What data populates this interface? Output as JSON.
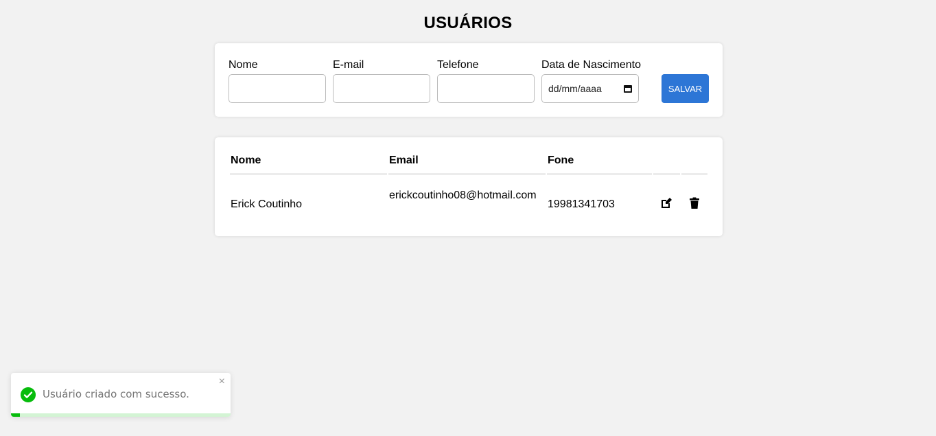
{
  "page": {
    "title": "USUÁRIOS"
  },
  "form": {
    "fields": [
      {
        "label": "Nome",
        "value": ""
      },
      {
        "label": "E-mail",
        "value": ""
      },
      {
        "label": "Telefone",
        "value": ""
      },
      {
        "label": "Data de Nascimento",
        "value": "dd/mm/aaaa"
      }
    ],
    "save_label": "SALVAR"
  },
  "table": {
    "headers": [
      "Nome",
      "Email",
      "Fone"
    ],
    "rows": [
      {
        "nome": "Erick Coutinho",
        "email": "erickcoutinho08@hotmail.com",
        "fone": "19981341703"
      }
    ]
  },
  "toast": {
    "message": "Usuário criado com sucesso.",
    "close_label": "×",
    "progress": 0.04
  },
  "colors": {
    "accent": "#2d76d6",
    "success": "#07bc0c",
    "background": "#f2f2f2"
  },
  "icons": {
    "edit": "edit-icon",
    "delete": "trash-icon",
    "calendar": "calendar-icon",
    "success": "check-circle-icon"
  }
}
